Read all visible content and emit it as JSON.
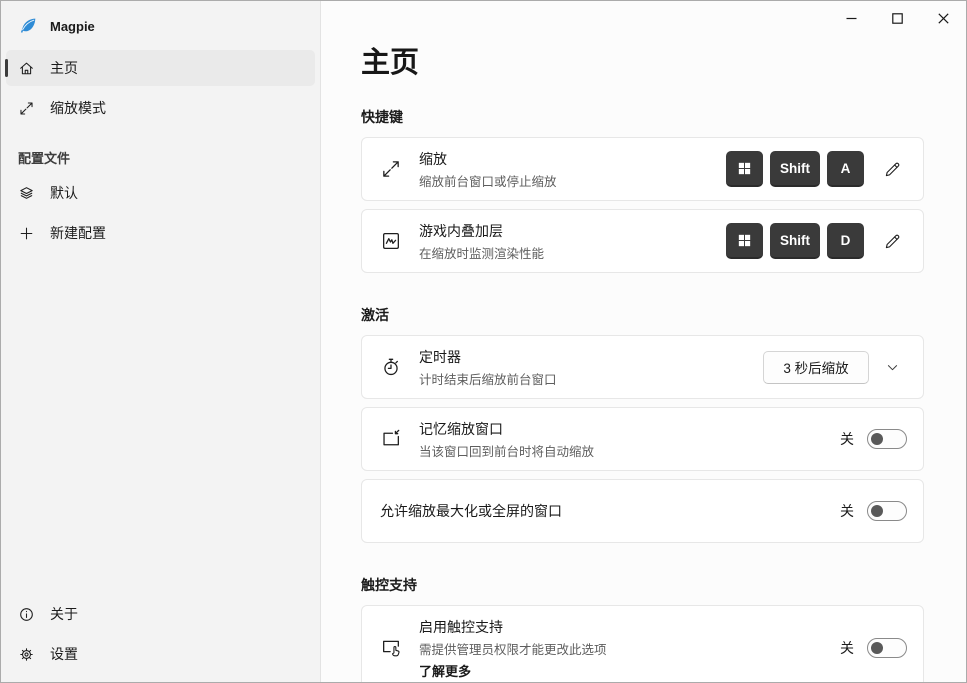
{
  "window": {
    "controls": [
      {
        "name": "minimize"
      },
      {
        "name": "maximize"
      },
      {
        "name": "close"
      }
    ]
  },
  "sidebar": {
    "app_name": "Magpie",
    "nav": [
      {
        "label": "主页",
        "selected": true
      },
      {
        "label": "缩放模式",
        "selected": false
      }
    ],
    "profiles_header": "配置文件",
    "profiles": [
      {
        "label": "默认"
      },
      {
        "label": "新建配置"
      }
    ],
    "footer": [
      {
        "label": "关于"
      },
      {
        "label": "设置"
      }
    ]
  },
  "main": {
    "title": "主页",
    "shortcuts": {
      "header": "快捷键",
      "cards": [
        {
          "title": "缩放",
          "subtitle": "缩放前台窗口或停止缩放",
          "keys": [
            "Win",
            "Shift",
            "A"
          ]
        },
        {
          "title": "游戏内叠加层",
          "subtitle": "在缩放时监测渲染性能",
          "keys": [
            "Win",
            "Shift",
            "D"
          ]
        }
      ]
    },
    "activation": {
      "header": "激活",
      "timer": {
        "title": "定时器",
        "subtitle": "计时结束后缩放前台窗口",
        "dropdown_value": "3 秒后缩放"
      },
      "remember": {
        "title": "记忆缩放窗口",
        "subtitle": "当该窗口回到前台时将自动缩放",
        "toggle_label": "关",
        "state": "off"
      },
      "allow_fullscreen": {
        "title": "允许缩放最大化或全屏的窗口",
        "toggle_label": "关",
        "state": "off"
      }
    },
    "touch": {
      "header": "触控支持",
      "enable": {
        "title": "启用触控支持",
        "subtitle": "需提供管理员权限才能更改此选项",
        "link": "了解更多",
        "toggle_label": "关",
        "state": "off"
      }
    }
  },
  "colors": {
    "logo_blue": "#2e8bd5",
    "key_bg": "#3a3a3a",
    "sidebar_bg": "#f3f3f3",
    "selected_item_bg": "#eaeaea"
  }
}
